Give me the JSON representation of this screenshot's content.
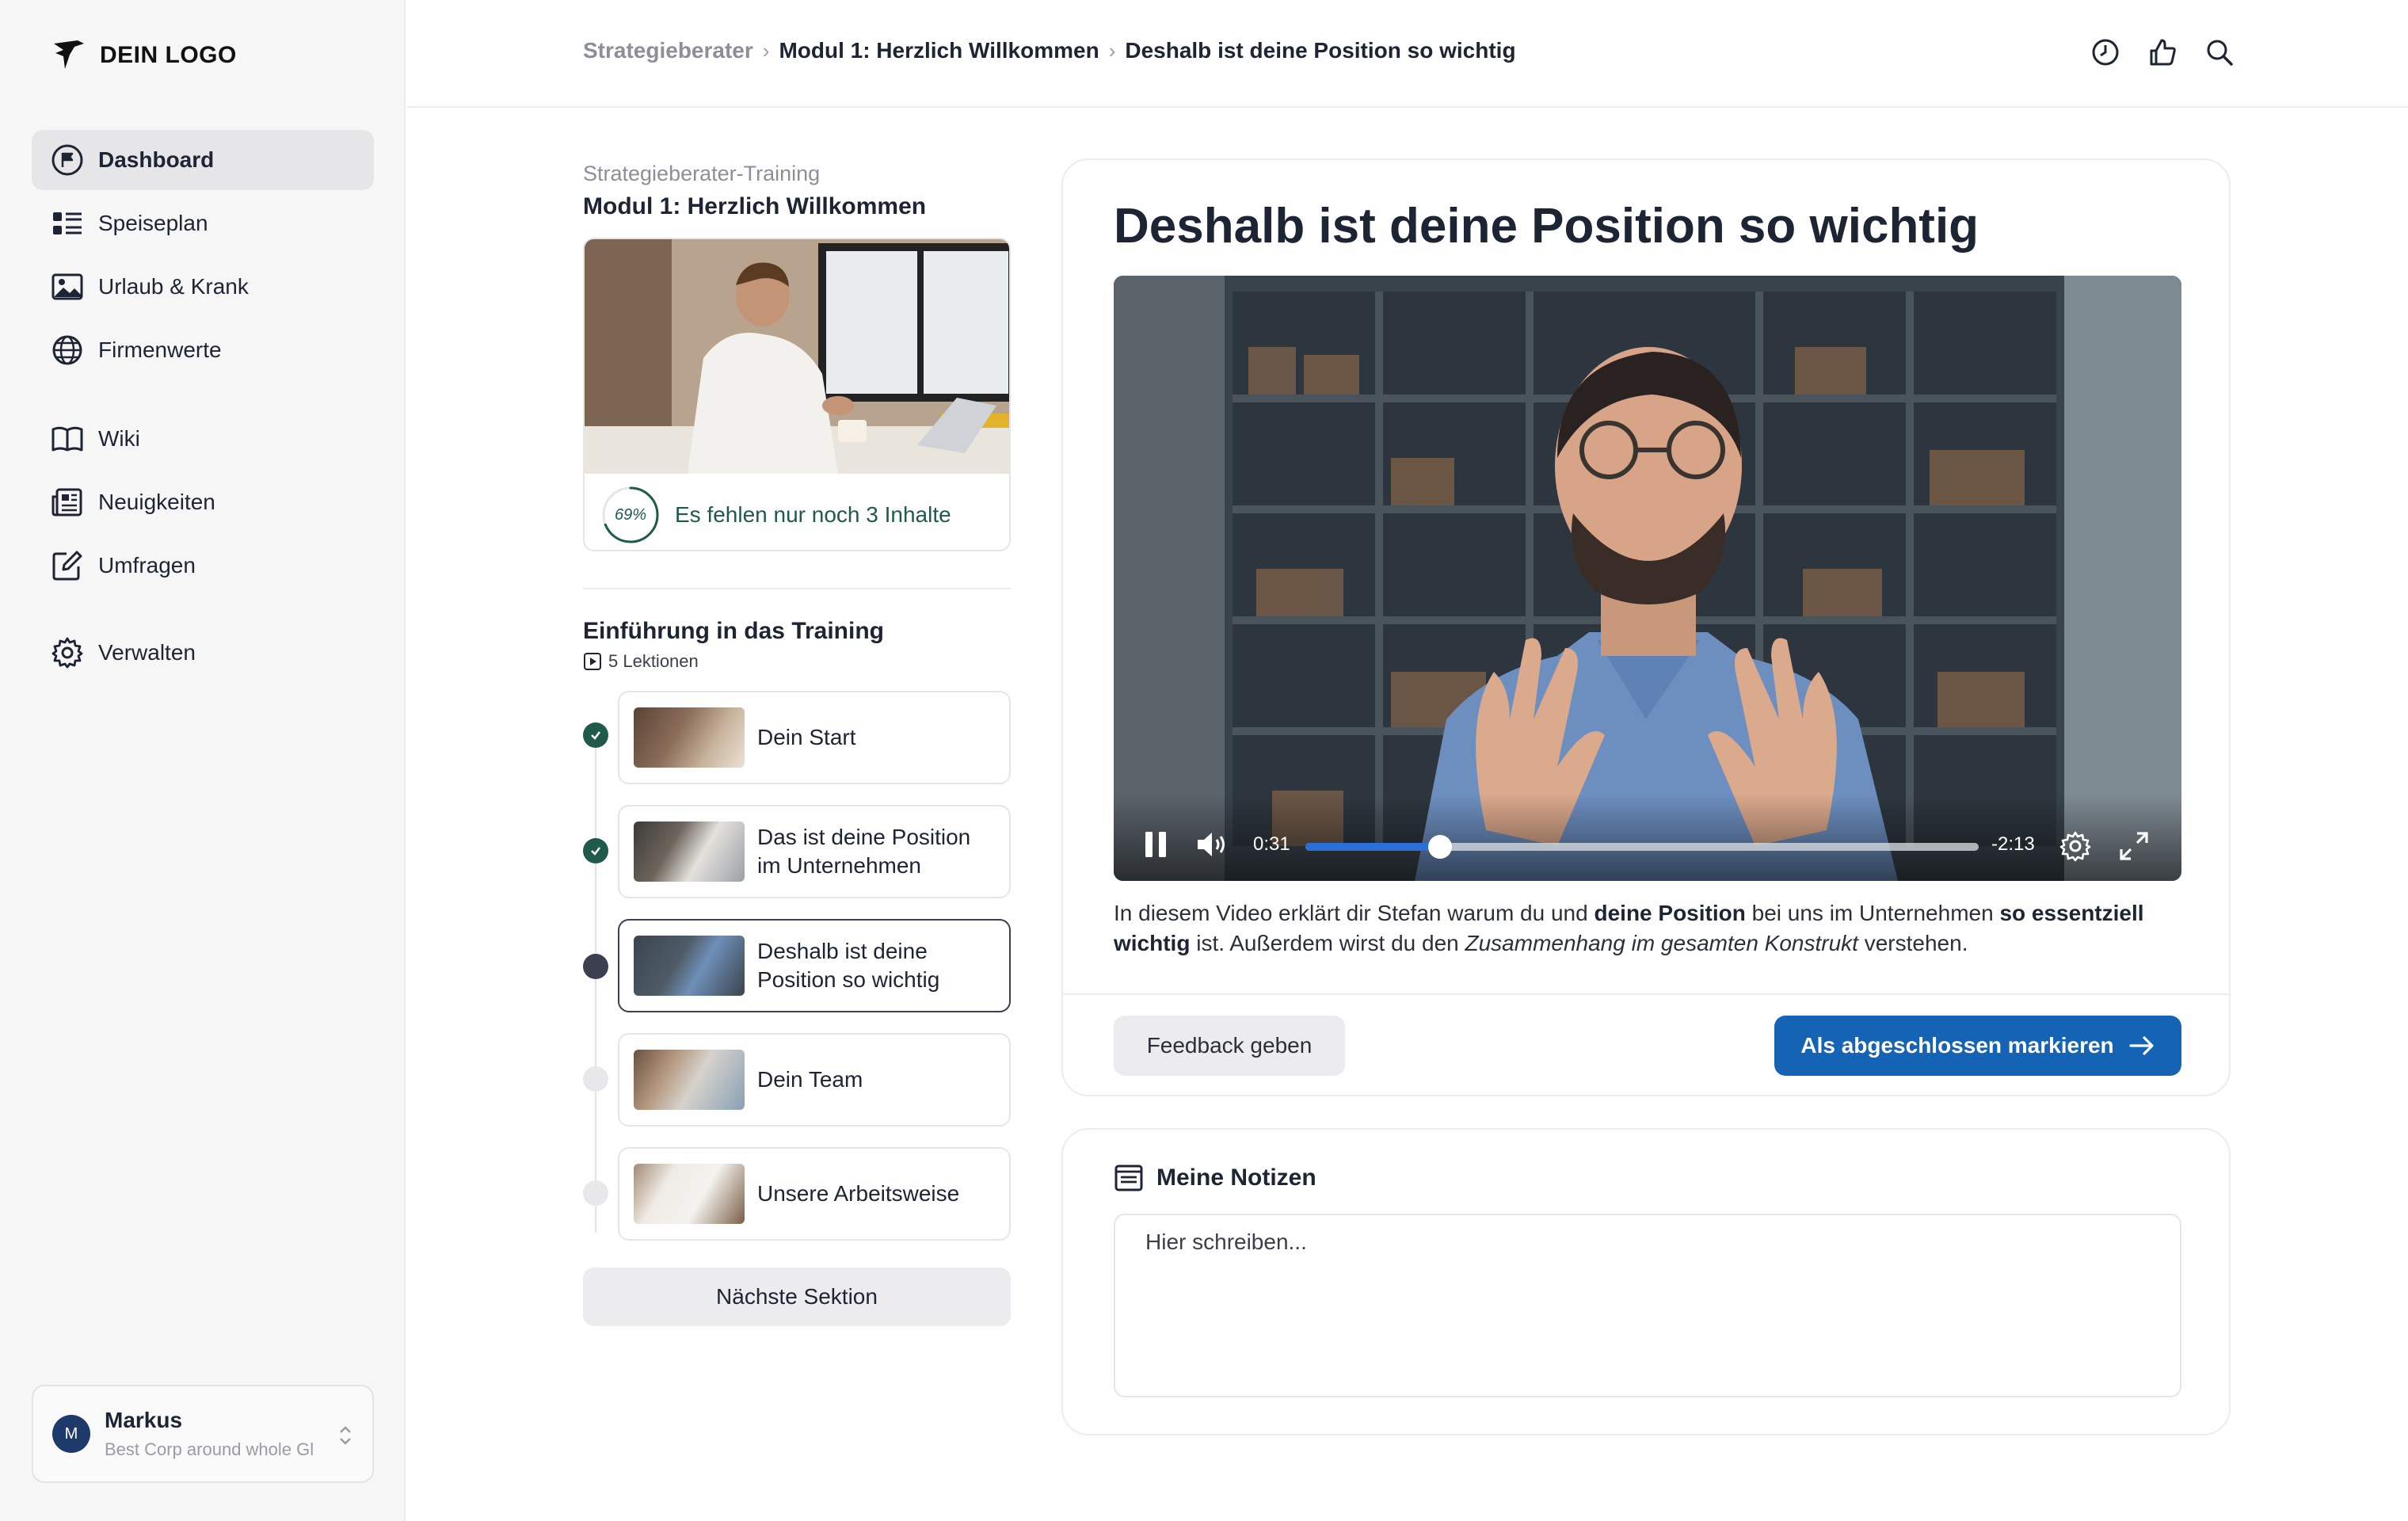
{
  "sidebar": {
    "logo_text": "DEIN LOGO",
    "nav": [
      {
        "label": "Dashboard",
        "icon": "flag-icon",
        "active": true
      },
      {
        "label": "Speiseplan",
        "icon": "list-icon"
      },
      {
        "label": "Urlaub & Krank",
        "icon": "image-icon"
      },
      {
        "label": "Firmenwerte",
        "icon": "globe-icon"
      },
      {
        "label": "Wiki",
        "icon": "book-icon"
      },
      {
        "label": "Neuigkeiten",
        "icon": "newspaper-icon"
      },
      {
        "label": "Umfragen",
        "icon": "edit-icon"
      },
      {
        "label": "Verwalten",
        "icon": "gear-icon"
      }
    ],
    "user": {
      "initial": "M",
      "name": "Markus",
      "org": "Best Corp around whole Gl"
    }
  },
  "breadcrumb": [
    "Strategieberater",
    "Modul 1: Herzlich Willkommen",
    "Deshalb ist deine Position so wichtig"
  ],
  "breadcrumb_sep": "›",
  "top_icons": [
    "history-icon",
    "thumbs-up-icon",
    "search-icon"
  ],
  "course": {
    "kicker": "Strategieberater-Training",
    "title": "Modul 1: Herzlich Willkommen",
    "progress_percent": 69,
    "progress_label": "69%",
    "progress_text": "Es fehlen nur noch 3 Inhalte"
  },
  "section": {
    "title": "Einführung in das Training",
    "meta": "5 Lektionen",
    "lessons": [
      {
        "line1": "Dein Start",
        "line2": "",
        "status": "done"
      },
      {
        "line1": "Das ist deine Position",
        "line2": "im Unternehmen",
        "status": "done"
      },
      {
        "line1": "Deshalb ist deine",
        "line2": "Position so wichtig",
        "status": "current"
      },
      {
        "line1": "Dein Team",
        "line2": "",
        "status": "todo"
      },
      {
        "line1": "Unsere Arbeitsweise",
        "line2": "",
        "status": "todo"
      }
    ],
    "next_label": "Nächste Sektion"
  },
  "video": {
    "title": "Deshalb ist deine Position so wichtig",
    "current_time": "0:31",
    "remaining_time": "-2:13",
    "progress_fraction": 0.2,
    "description_parts": [
      {
        "t": "In diesem Video erklärt dir Stefan warum du und ",
        "s": "n"
      },
      {
        "t": "deine Position",
        "s": "b"
      },
      {
        "t": " bei uns im Unternehmen ",
        "s": "n"
      },
      {
        "t": "so essentziell wichtig",
        "s": "b"
      },
      {
        "t": " ist. Außerdem wirst du den ",
        "s": "n"
      },
      {
        "t": "Zusammenhang im gesamten Konstrukt",
        "s": "i"
      },
      {
        "t": " verstehen.",
        "s": "n"
      }
    ],
    "feedback_label": "Feedback geben",
    "complete_label": "Als abgeschlossen markieren"
  },
  "notes": {
    "title": "Meine Notizen",
    "placeholder": "Hier schreiben..."
  },
  "colors": {
    "primary": "#1563b4",
    "success": "#1f5a4a",
    "current": "#3a4050",
    "progress_blue": "#2a6fd6"
  }
}
